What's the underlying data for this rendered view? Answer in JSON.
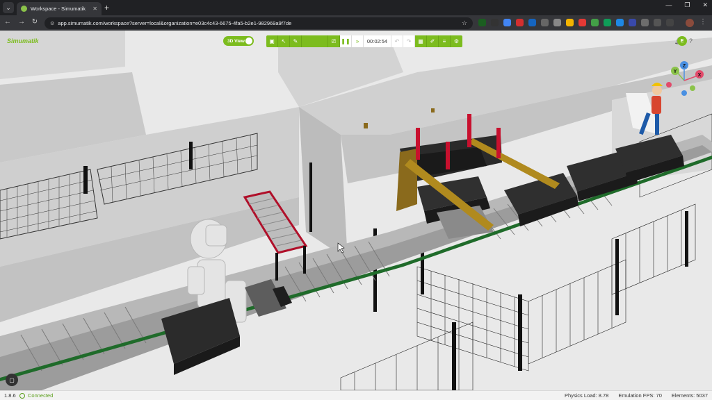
{
  "browser": {
    "tab_title": "Workspace - Simumatik",
    "url": "app.simumatik.com/workspace?server=local&organization=e03c4c43-6675-4fa5-b2e1-982969a9f7de"
  },
  "app": {
    "logo": "Simumatik",
    "view_toggle_label": "3D View",
    "timer": "00:02:54",
    "user_initial": "E"
  },
  "status": {
    "version": "1.8.6",
    "connection": "Connected",
    "physics_load": "Physics Load: 8.78",
    "emulation_fps": "Emulation FPS: 70",
    "elements": "Elements: 5037"
  },
  "gizmo": {
    "y": "Y",
    "z": "Z",
    "x": "X"
  },
  "colors": {
    "accent": "#7cbc1e",
    "tray": "#2a2a2a",
    "red": "#c8102e",
    "beam": "#b08a1e"
  }
}
